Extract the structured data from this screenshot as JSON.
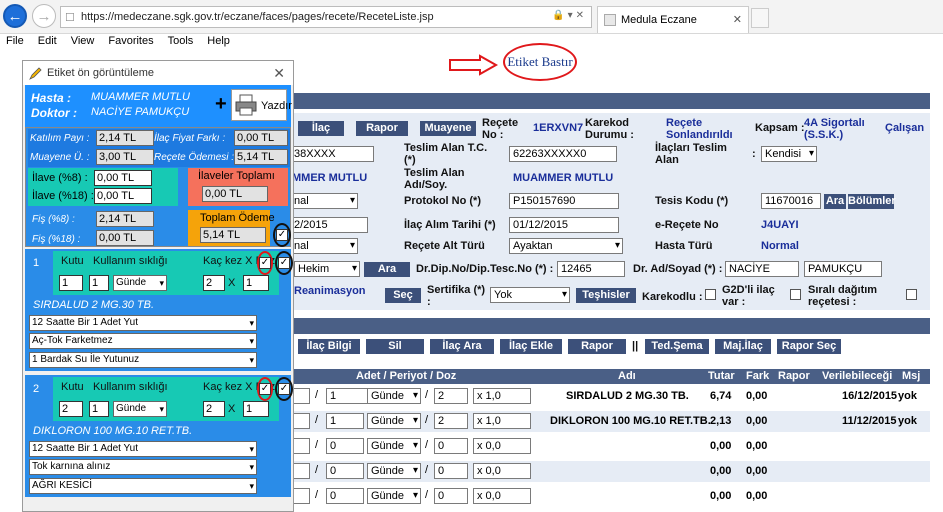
{
  "browser": {
    "url": "https://medeczane.sgk.gov.tr/eczane/faces/pages/recete/ReceteListe.jsp",
    "tab_title": "Medula Eczane"
  },
  "menu": [
    "File",
    "Edit",
    "View",
    "Favorites",
    "Tools",
    "Help"
  ],
  "etiket_link": "Etiket Bastır",
  "buttons_top": [
    "İlaç",
    "Rapor",
    "Muayene"
  ],
  "recete": {
    "no_label": "Reçete No :",
    "no": "1ERXVN7",
    "karekod_label": "Karekod Durumu :",
    "karekod": "Reçete Sonlandırıldı",
    "kapsam_label": "Kapsam :",
    "kapsam": "4A Sigortalı (S.S.K.)",
    "calisan": "Çalışan"
  },
  "form": {
    "tc_label": "Teslim Alan T.C. (*)",
    "tc_val": "62263XXXXX0",
    "tc_left": "38XXXX",
    "ilac_teslim_label": "İlaçları Teslim Alan",
    "ilac_teslim_val": "Kendisi",
    "adsoy_label": "Teslim Alan Adı/Soy.",
    "adsoy_val": "MUAMMER MUTLU",
    "hasta_left": "MMER MUTLU",
    "protokol_label": "Protokol No (*)",
    "protokol_val": "P150157690",
    "tesis_label": "Tesis Kodu (*)",
    "tesis_val": "11670016",
    "ara": "Ara",
    "bolumler": "Bölümler",
    "alim_label": "İlaç Alım Tarihi (*)",
    "alim_val": "01/12/2015",
    "left_date": "2/2015",
    "erecete_label": "e-Reçete No",
    "erecete_val": "J4UAYI",
    "alt_turu_label": "Reçete Alt Türü",
    "alt_turu_val": "Ayaktan",
    "hasta_turu_label": "Hasta Türü",
    "hasta_turu_val": "Normal",
    "left_sel1": "nal",
    "left_sel2": "nal",
    "hekim": "Hekim",
    "ara2": "Ara",
    "dip_label": "Dr.Dip.No/Dip.Tesc.No (*) :",
    "dip_val": "12465",
    "dr_label": "Dr. Ad/Soyad (*) :",
    "dr_ad": "NACİYE",
    "dr_soyad": "PAMUKÇU",
    "reanimasyon": "Reanimasyon",
    "sec": "Seç",
    "sertifika_label": "Sertifika (*) :",
    "sertifika_val": "Yok",
    "teshisler": "Teşhisler",
    "karekodlu": "Karekodlu :",
    "g2d": "G2D'li ilaç var :",
    "sirali": "Sıralı dağıtım reçetesi :"
  },
  "toolbar": [
    "İlaç Bilgi",
    "Sil",
    "İlaç Ara",
    "İlaç Ekle",
    "Rapor",
    "||",
    "Ted.Şema",
    "Maj.İlaç",
    "Rapor Seç"
  ],
  "table": {
    "headers": [
      "Adet / Periyot / Doz",
      "Adı",
      "Tutar",
      "Fark",
      "Rapor",
      "Verilebileceği",
      "Msj"
    ],
    "rows": [
      {
        "adet": "1",
        "periyot": "Günde",
        "doz1": "2",
        "doz2": "x 1,0",
        "name": "SIRDALUD 2 MG.30 TB.",
        "tutar": "6,74",
        "fark": "0,00",
        "rapor": "",
        "verilebilecegi": "16/12/2015",
        "msj": "yok"
      },
      {
        "adet": "1",
        "periyot": "Günde",
        "doz1": "2",
        "doz2": "x 1,0",
        "name": "DIKLORON 100 MG.10 RET.TB.",
        "tutar": "2,13",
        "fark": "0,00",
        "rapor": "",
        "verilebilecegi": "11/12/2015",
        "msj": "yok"
      },
      {
        "adet": "0",
        "periyot": "Günde",
        "doz1": "0",
        "doz2": "x 0,0",
        "name": "",
        "tutar": "0,00",
        "fark": "0,00",
        "rapor": "",
        "verilebilecegi": "",
        "msj": ""
      },
      {
        "adet": "0",
        "periyot": "Günde",
        "doz1": "0",
        "doz2": "x 0,0",
        "name": "",
        "tutar": "0,00",
        "fark": "0,00",
        "rapor": "",
        "verilebilecegi": "",
        "msj": ""
      },
      {
        "adet": "0",
        "periyot": "Günde",
        "doz1": "0",
        "doz2": "x 0,0",
        "name": "",
        "tutar": "0,00",
        "fark": "0,00",
        "rapor": "",
        "verilebilecegi": "",
        "msj": ""
      }
    ]
  },
  "dialog": {
    "title": "Etiket ön görüntüleme",
    "hasta_label": "Hasta :",
    "hasta": "MUAMMER MUTLU",
    "doktor_label": "Doktor :",
    "doktor": "NACİYE PAMUKÇU",
    "plus": "+",
    "yazdir": "Yazdır",
    "katilim_label": "Katılım Payı :",
    "katilim": "2,14 TL",
    "ilac_fark_label": "İlaç Fiyat Farkı :",
    "ilac_fark": "0,00 TL",
    "muayene_label": "Muayene Ü. :",
    "muayene": "3,00 TL",
    "recete_odemesi_label": "Reçete Ödemesi :",
    "recete_odemesi": "5,14 TL",
    "ilave8_label": "İlave (%8) :",
    "ilave8": "0,00 TL",
    "ilave18_label": "İlave (%18) :",
    "ilave18": "0,00 TL",
    "ilaveler_label": "İlaveler Toplamı",
    "ilaveler": "0,00 TL",
    "fis8_label": "Fiş (%8) :",
    "fis8": "2,14 TL",
    "fis18_label": "Fiş (%18) :",
    "fis18": "0,00 TL",
    "toplam_label": "Toplam Ödeme",
    "toplam": "5,14 TL",
    "col_kutu": "Kutu",
    "col_kullanim": "Kullanım sıklığı",
    "col_kac": "Kaç kez X Doz",
    "x": "X",
    "meds": [
      {
        "idx": "1",
        "kutu": "1",
        "kul1": "1",
        "kul_period": "Günde",
        "kac": "2",
        "doz": "1",
        "name": "SIRDALUD 2 MG.30 TB.",
        "opt1": "12 Saatte Bir 1 Adet Yut",
        "opt2": "Aç-Tok Farketmez",
        "opt3": "1 Bardak Su İle Yutunuz"
      },
      {
        "idx": "2",
        "kutu": "2",
        "kul1": "1",
        "kul_period": "Günde",
        "kac": "2",
        "doz": "1",
        "name": "DIKLORON 100 MG.10 RET.TB.",
        "opt1": "12 Saatte Bir 1 Adet Yut",
        "opt2": "Tok karnına alınız",
        "opt3": "AĞRI KESİCİ"
      }
    ]
  },
  "colors": {
    "accent_blue": "#1e90ff",
    "teal": "#17c9b4",
    "header_bar": "#4a5f86",
    "red_ring": "#e0181b",
    "black_ring": "#111111"
  }
}
